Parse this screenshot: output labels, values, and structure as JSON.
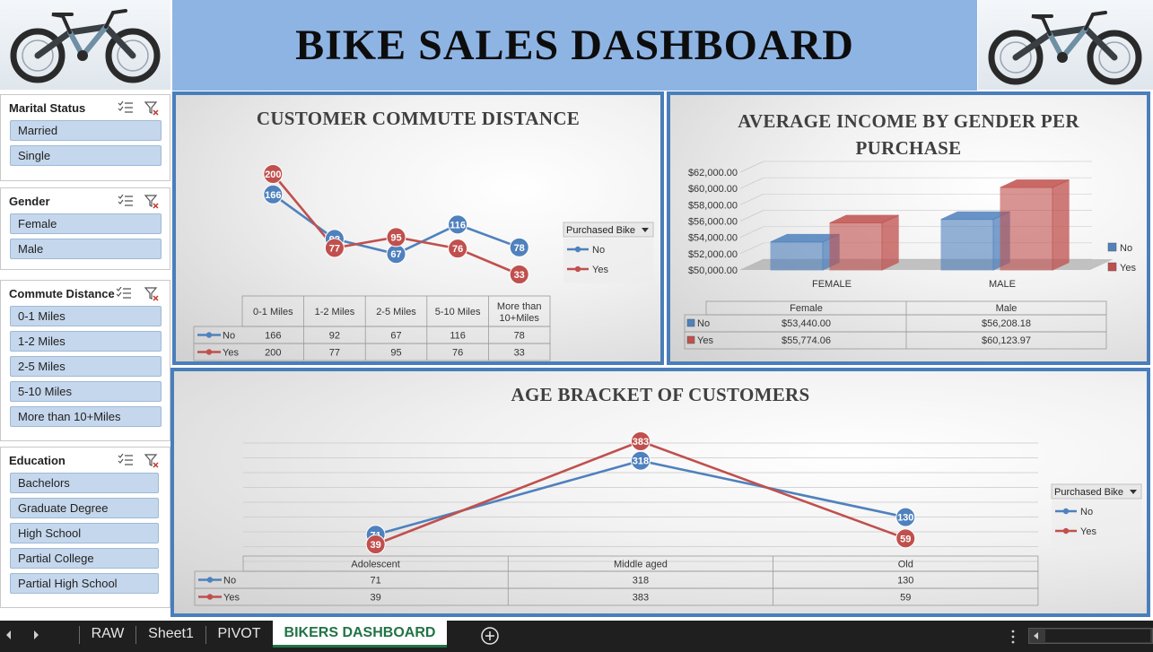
{
  "title": "BIKE SALES DASHBOARD",
  "slicers": {
    "marital": {
      "title": "Marital Status",
      "items": [
        "Married",
        "Single"
      ]
    },
    "gender": {
      "title": "Gender",
      "items": [
        "Female",
        "Male"
      ]
    },
    "commute": {
      "title": "Commute Distance",
      "items": [
        "0-1 Miles",
        "1-2 Miles",
        "2-5 Miles",
        "5-10 Miles",
        "More than 10+Miles"
      ]
    },
    "education": {
      "title": "Education",
      "items": [
        "Bachelors",
        "Graduate Degree",
        "High School",
        "Partial College",
        "Partial High School"
      ]
    }
  },
  "tabs": {
    "raw": "RAW",
    "sheet1": "Sheet1",
    "pivot": "PIVOT",
    "dashboard": "BIKERS DASHBOARD"
  },
  "colors": {
    "no": "#4f81bd",
    "yes": "#c0504d",
    "accent": "#4a7ebb",
    "header": "#8eb4e3",
    "slicer_item": "#c5d7ec"
  },
  "chart_data": [
    {
      "type": "line",
      "title": "CUSTOMER COMMUTE DISTANCE",
      "categories": [
        "0-1 Miles",
        "1-2 Miles",
        "2-5 Miles",
        "5-10 Miles",
        "More than 10+Miles"
      ],
      "legend_title": "Purchased Bike",
      "legend_position": "right",
      "series": [
        {
          "name": "No",
          "values": [
            166,
            92,
            67,
            116,
            78
          ]
        },
        {
          "name": "Yes",
          "values": [
            200,
            77,
            95,
            76,
            33
          ]
        }
      ],
      "data_table": true
    },
    {
      "type": "bar",
      "title": "AVERAGE INCOME BY GENDER PER PURCHASE",
      "categories": [
        "FEMALE",
        "MALE"
      ],
      "table_categories": [
        "Female",
        "Male"
      ],
      "yticks": [
        "$50,000.00",
        "$52,000.00",
        "$54,000.00",
        "$56,000.00",
        "$58,000.00",
        "$60,000.00",
        "$62,000.00"
      ],
      "ylim": [
        50000,
        62000
      ],
      "legend_position": "right",
      "series": [
        {
          "name": "No",
          "values": [
            53440.0,
            56208.18
          ],
          "labels": [
            "$53,440.00",
            "$56,208.18"
          ]
        },
        {
          "name": "Yes",
          "values": [
            55774.06,
            60123.97
          ],
          "labels": [
            "$55,774.06",
            "$60,123.97"
          ]
        }
      ],
      "data_table": true
    },
    {
      "type": "line",
      "title": "AGE BRACKET OF CUSTOMERS",
      "categories": [
        "Adolescent",
        "Middle aged",
        "Old"
      ],
      "legend_title": "Purchased Bike",
      "legend_position": "right",
      "series": [
        {
          "name": "No",
          "values": [
            71,
            318,
            130
          ]
        },
        {
          "name": "Yes",
          "values": [
            39,
            383,
            59
          ]
        }
      ],
      "grid": true,
      "data_table": true
    }
  ]
}
